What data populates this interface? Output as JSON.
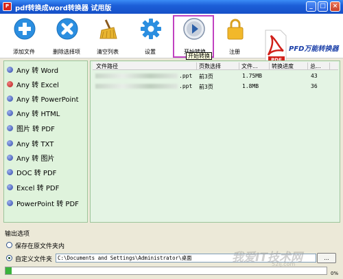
{
  "window": {
    "title": "pdf转换成word转换器 试用版",
    "minimize": "_",
    "maximize": "□",
    "close": "×"
  },
  "toolbar": {
    "items": [
      {
        "label": "添加文件",
        "icon": "add-icon"
      },
      {
        "label": "删除选择项",
        "icon": "delete-icon"
      },
      {
        "label": "清空列表",
        "icon": "broom-icon"
      },
      {
        "label": "设置",
        "icon": "gear-icon"
      },
      {
        "label": "开始转换",
        "icon": "play-icon"
      },
      {
        "label": "注册",
        "icon": "lock-icon"
      }
    ],
    "tooltip": "开始转换",
    "brand": "PFD万能转换器"
  },
  "modes": [
    "Any 转 Word",
    "Any 转 Excel",
    "Any 转 PowerPoint",
    "Any 转 HTML",
    "图片 转 PDF",
    "Any 转 TXT",
    "Any 转 图片",
    "DOC 转 PDF",
    "Excel 转 PDF",
    "PowerPoint 转 PDF"
  ],
  "table": {
    "headers": [
      "文件路径",
      "页数选择",
      "文件...",
      "转换进度",
      "总..."
    ],
    "rows": [
      {
        "path": ".ppt",
        "pages": "前3页",
        "size": "1.75MB",
        "progress": "",
        "total": "43"
      },
      {
        "path": ".ppt",
        "pages": "前3页",
        "size": "1.8MB",
        "progress": "",
        "total": "36"
      }
    ]
  },
  "output": {
    "title": "输出选项",
    "option_source": "保存在原文件夹内",
    "option_custom": "自定义文件夹",
    "path": "C:\\Documents and Settings\\Administrator\\桌面",
    "browse": "...",
    "selected": "custom"
  },
  "progress": {
    "value": 0.02,
    "label": "0%"
  },
  "watermark": {
    "text": "我爱IT技术网",
    "sub": "52ij.com"
  },
  "colors": {
    "titlebar": "#1c5fd8",
    "panel_bg": "#dff3dc",
    "highlight": "#c040c0",
    "progress_fill": "#3bb33b"
  }
}
